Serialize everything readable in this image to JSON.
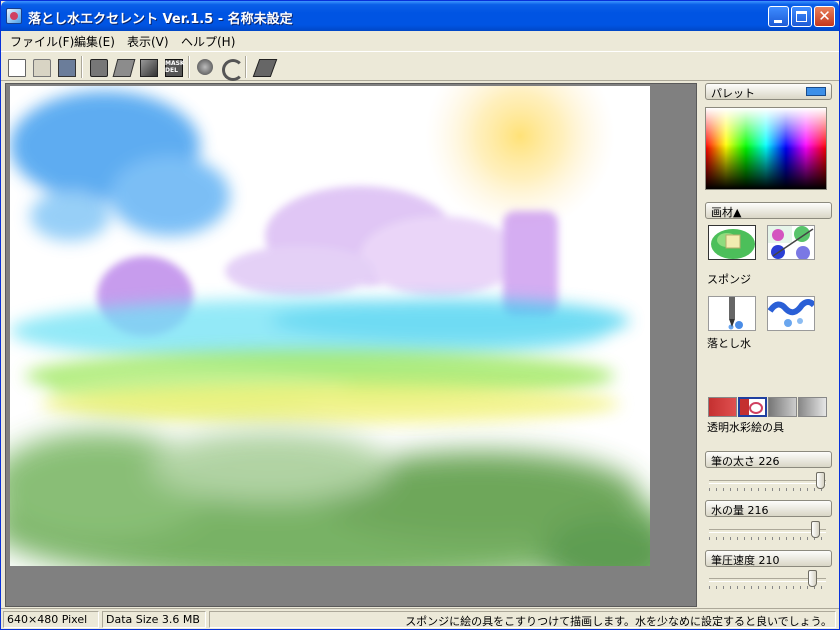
{
  "window": {
    "title": "落とし水エクセレント Ver.1.5 - 名称未設定",
    "close_glyph": "✕"
  },
  "menu": {
    "items": [
      "ファイル(F)",
      "編集(E)",
      "表示(V)",
      "ヘルプ(H)"
    ]
  },
  "toolbar": {
    "mask_icon_text": "MASK DEL",
    "icons": [
      "new-document-icon",
      "open-folder-icon",
      "save-icon",
      "brush-set-icon",
      "layer-icon",
      "edit-icon",
      "mask-delete-icon",
      "blend-icon",
      "undo-icon",
      "eraser-icon"
    ]
  },
  "panel": {
    "palette_label": "パレット",
    "palette_color": "#3c8fe8",
    "materials_label": "画材▲",
    "tools": [
      {
        "label": "スポンジ",
        "selected": true
      },
      {
        "label": ""
      },
      {
        "label": "落とし水"
      },
      {
        "label": ""
      }
    ],
    "paint_label": "透明水彩絵の具",
    "sliders": [
      {
        "label": "筆の太さ 226",
        "value": 226,
        "max": 255
      },
      {
        "label": "水の量 216",
        "value": 216,
        "max": 255
      },
      {
        "label": "筆圧速度 210",
        "value": 210,
        "max": 255
      }
    ]
  },
  "status": {
    "resolution": "640×480 Pixel",
    "data_size": "Data Size 3.6 MB",
    "hint": "スポンジに絵の具をこすりつけて描画します。水を少なめに設定すると良いでしょう。"
  }
}
